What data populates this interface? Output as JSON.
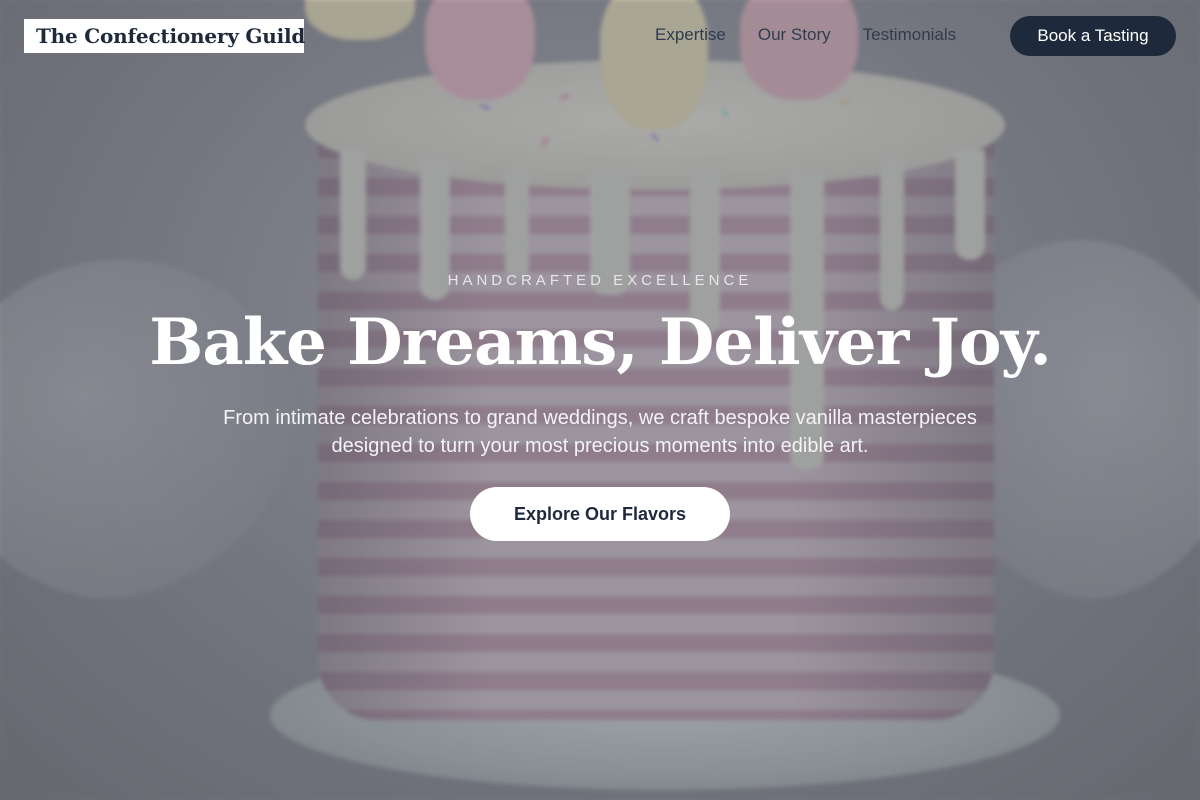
{
  "brand": {
    "name": "The Confectionery Guild"
  },
  "nav": {
    "links": [
      {
        "label": "Expertise"
      },
      {
        "label": "Our Story"
      },
      {
        "label": "Testimonials"
      }
    ],
    "cta_label": "Book a Tasting"
  },
  "hero": {
    "eyebrow": "HANDCRAFTED EXCELLENCE",
    "headline": "Bake Dreams, Deliver Joy.",
    "subheadline": "From intimate celebrations to grand weddings, we craft bespoke vanilla masterpieces designed to turn your most precious moments into edible art.",
    "cta_label": "Explore Our Flavors",
    "background_image": "pink-striped-drip-cake-with-macarons"
  },
  "colors": {
    "brand_navy": "#1e2a3b",
    "white": "#ffffff",
    "overlay": "#5c5e69"
  }
}
